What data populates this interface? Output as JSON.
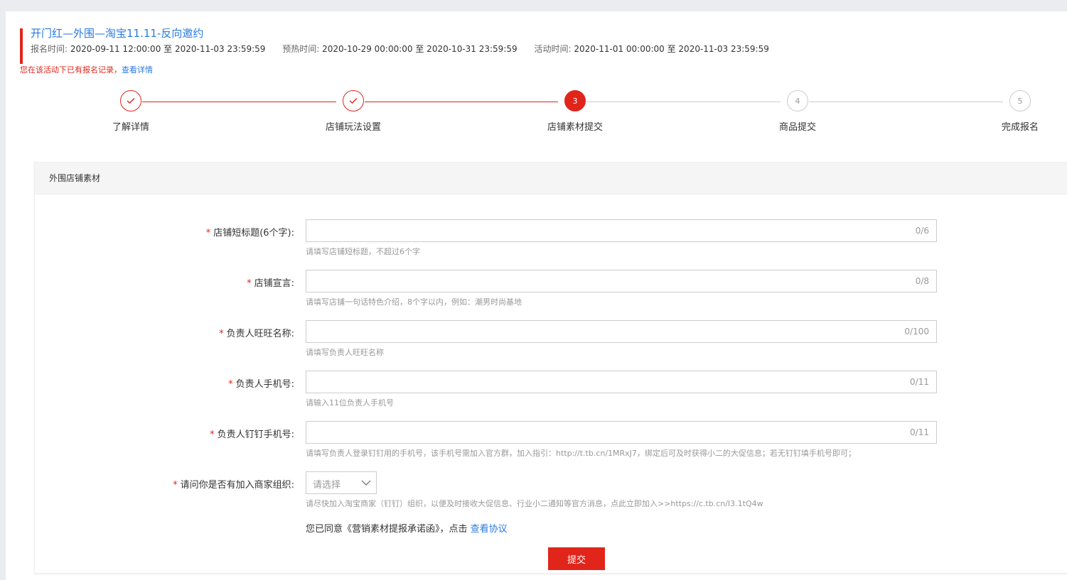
{
  "activity": {
    "title": "开门红—外围—淘宝11.11-反向邀约",
    "signup_label": "报名时间:",
    "signup_range": "2020-09-11 12:00:00 至 2020-11-03 23:59:59",
    "preheat_label": "预热时间:",
    "preheat_range": "2020-10-29 00:00:00 至 2020-10-31 23:59:59",
    "event_label": "活动时间:",
    "event_range": "2020-11-01 00:00:00 至 2020-11-03 23:59:59",
    "notice_text": "您在该活动下已有报名记录，",
    "notice_link": "查看详情"
  },
  "steps": [
    {
      "label": "了解详情",
      "state": "done",
      "number": "1"
    },
    {
      "label": "店铺玩法设置",
      "state": "done",
      "number": "2"
    },
    {
      "label": "店铺素材提交",
      "state": "active",
      "number": "3"
    },
    {
      "label": "商品提交",
      "state": "todo",
      "number": "4"
    },
    {
      "label": "完成报名",
      "state": "todo",
      "number": "5"
    }
  ],
  "colors": {
    "accent": "#e1251b",
    "link": "#2a7ae2"
  },
  "panel": {
    "title": "外围店铺素材",
    "fields": [
      {
        "required": "*",
        "label": "店铺短标题(6个字):",
        "value": "",
        "counter": "0/6",
        "hint": "请填写店铺短标题，不超过6个字"
      },
      {
        "required": "*",
        "label": "店铺宣言:",
        "value": "",
        "counter": "0/8",
        "hint": "请填写店铺一句话特色介绍，8个字以内，例如：潮男时尚基地"
      },
      {
        "required": "*",
        "label": "负责人旺旺名称:",
        "value": "",
        "counter": "0/100",
        "hint": "请填写负责人旺旺名称"
      },
      {
        "required": "*",
        "label": "负责人手机号:",
        "value": "",
        "counter": "0/11",
        "hint": "请输入11位负责人手机号"
      },
      {
        "required": "*",
        "label": "负责人钉钉手机号:",
        "value": "",
        "counter": "0/11",
        "hint": "请填写负责人登录钉钉用的手机号，该手机号需加入官方群，加入指引：http://t.tb.cn/1MRxJ7，绑定后可及时获得小二的大促信息；若无钉钉填手机号即可；"
      }
    ],
    "org": {
      "required": "*",
      "label": "请问你是否有加入商家组织:",
      "placeholder": "请选择",
      "hint": "请尽快加入淘宝商家（钉钉）组织，以便及时接收大促信息、行业小二通知等官方消息，点此立即加入>>https://c.tb.cn/I3.1tQ4w"
    },
    "agree_text": "您已同意《营销素材提报承诺函》，点击",
    "agree_link": "查看协议",
    "submit_label": "提交"
  }
}
